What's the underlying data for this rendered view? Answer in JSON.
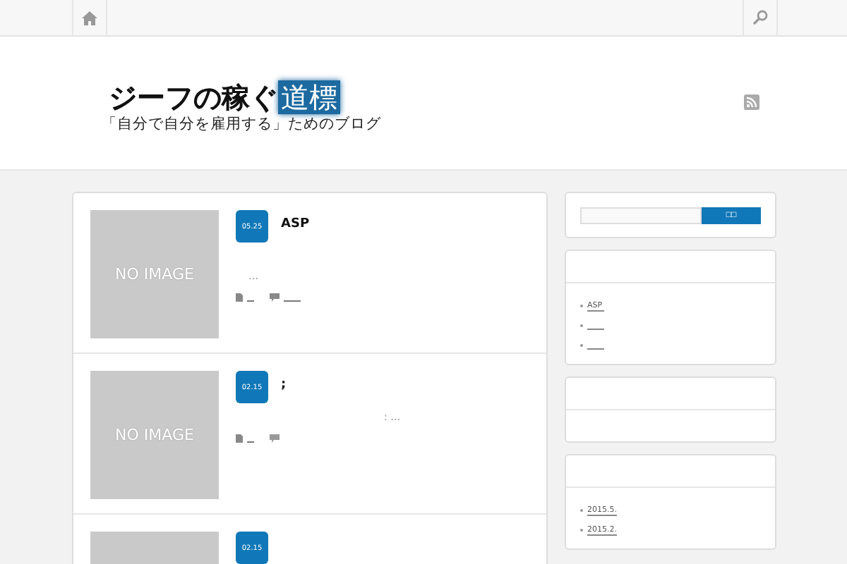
{
  "site": {
    "title": "ジーフの稼ぐ",
    "title_highlight": "道標",
    "tagline": "「自分で自分を雇用する」ためのブログ"
  },
  "posts": [
    {
      "date": "05.25",
      "title": "ASP",
      "excerpt": "…",
      "thumb_text": "NO IMAGE",
      "comments": true
    },
    {
      "date": "02.15",
      "title": ";",
      "excerpt": ": …",
      "thumb_text": "NO IMAGE",
      "comments": false
    },
    {
      "date": "02.15"
    }
  ],
  "search": {
    "button": "□□"
  },
  "widgets": [
    {
      "kind": "links",
      "links": [
        {
          "kind": "text",
          "text": "ASP"
        },
        {
          "kind": "blank"
        },
        {
          "kind": "blank"
        }
      ]
    },
    {
      "kind": "empty"
    },
    {
      "kind": "links",
      "links": [
        {
          "kind": "text",
          "text": "2015.5."
        },
        {
          "kind": "text",
          "text": "2015.2."
        }
      ]
    }
  ]
}
